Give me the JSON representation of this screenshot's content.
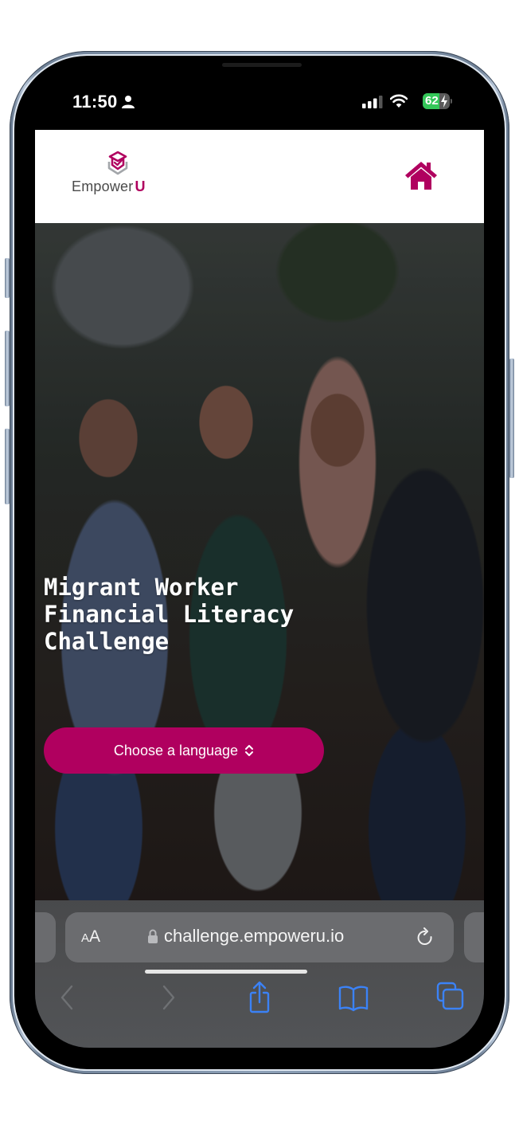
{
  "status_bar": {
    "time": "11:50",
    "person_icon": "person-icon",
    "signal_icon": "cellular-signal-icon",
    "wifi_icon": "wifi-icon",
    "battery_level": 62,
    "battery_text": "62",
    "charging_icon": "bolt-icon"
  },
  "header": {
    "logo_icon": "graduation-cap-hexagon-icon",
    "logo_text_main": "Empower",
    "logo_text_accent": "U",
    "home_icon": "home-icon"
  },
  "hero": {
    "title": "Migrant Worker Financial Literacy Challenge",
    "language_button_label": "Choose a language",
    "language_button_icon": "chevron-up-down-icon"
  },
  "browser": {
    "text_size_label_small": "A",
    "text_size_label_large": "A",
    "lock_icon": "lock-icon",
    "url": "challenge.empoweru.io",
    "reload_icon": "reload-icon",
    "toolbar": [
      {
        "name": "back",
        "icon": "chevron-left-icon",
        "enabled": false
      },
      {
        "name": "forward",
        "icon": "chevron-right-icon",
        "enabled": false
      },
      {
        "name": "share",
        "icon": "share-icon",
        "enabled": true
      },
      {
        "name": "bookmarks",
        "icon": "book-icon",
        "enabled": true
      },
      {
        "name": "tabs",
        "icon": "tabs-icon",
        "enabled": true
      }
    ]
  },
  "colors": {
    "brand": "#b0005f",
    "logo_grey": "#9a9ea3",
    "safari_accent": "#3b82f6",
    "battery_green": "#34c759"
  }
}
